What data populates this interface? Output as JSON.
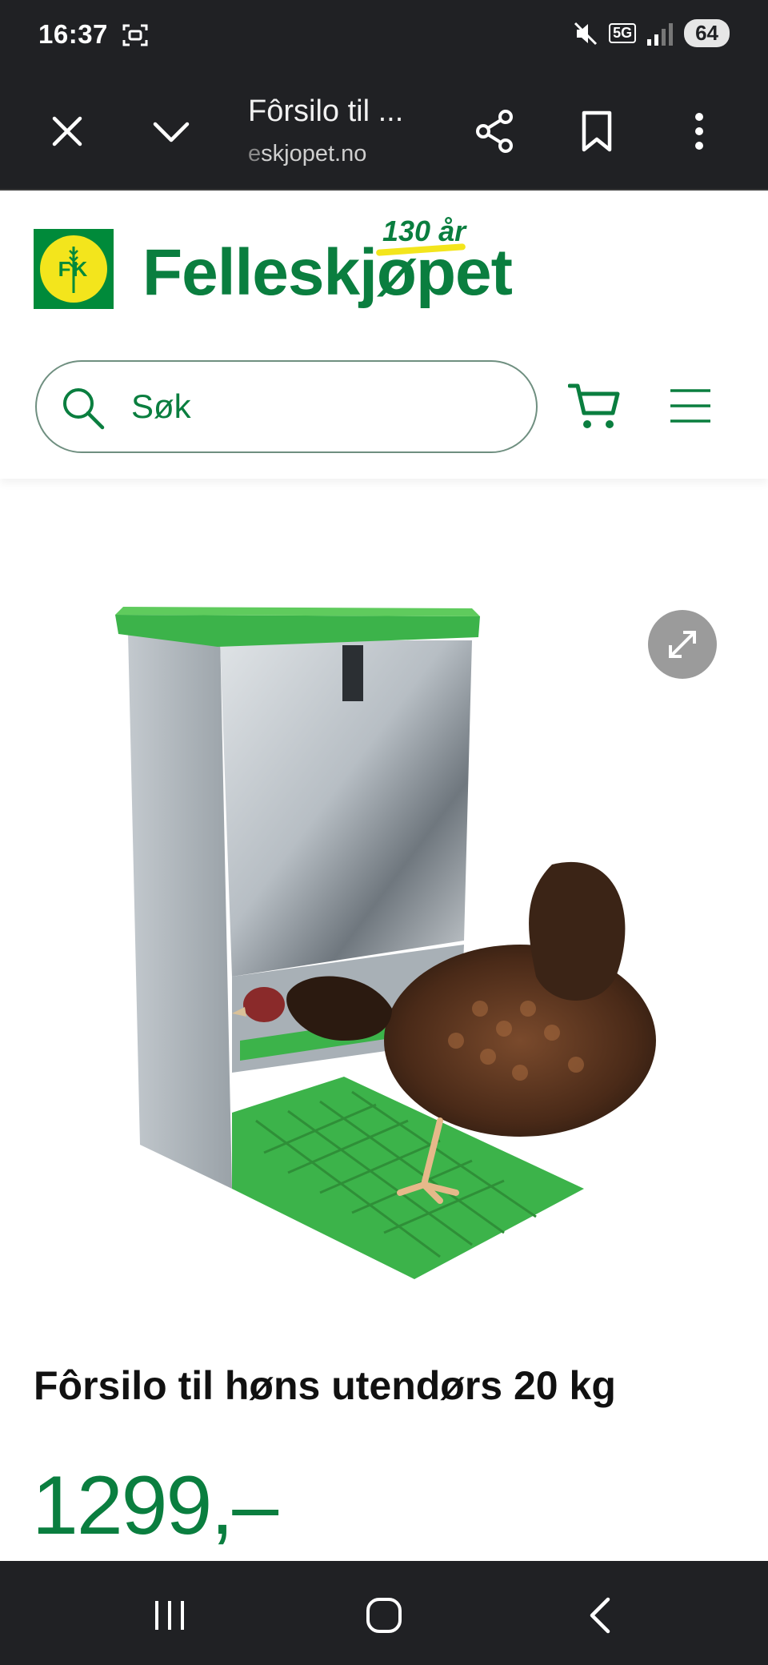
{
  "status_bar": {
    "time": "16:37",
    "network": "5G",
    "battery": "64"
  },
  "browser": {
    "tab_title": "Fôrsilo til ...",
    "url_prefix": "e",
    "url_rest": "skjopet.no"
  },
  "site": {
    "logo_initials": "FK",
    "brand_name": "Felleskjøpet",
    "anniversary": "130 år",
    "search_placeholder": "Søk"
  },
  "product": {
    "title": "Fôrsilo til høns utendørs 20 kg",
    "price": "1299,–"
  },
  "colors": {
    "brand_green": "#0a7e3f",
    "logo_yellow": "#f3e51c",
    "chrome_dark": "#202124",
    "feeder_green": "#3cb34a"
  }
}
